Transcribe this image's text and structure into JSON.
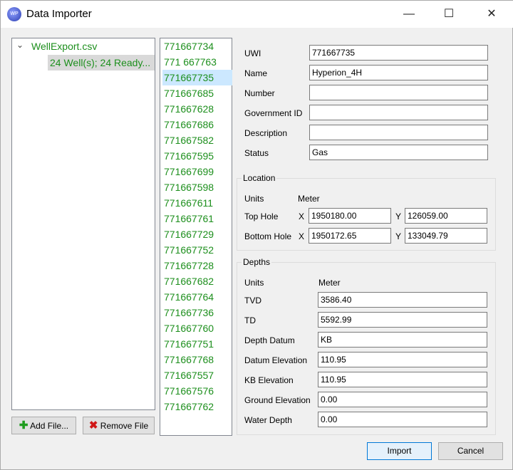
{
  "window": {
    "title": "Data Importer",
    "icon": "wp-logo-icon",
    "controls": [
      "minimize",
      "maximize",
      "close"
    ]
  },
  "tree": {
    "file": "WellExport.csv",
    "child": "24 Well(s); 24 Ready..."
  },
  "buttons": {
    "add_file": "Add File...",
    "remove_file": "Remove File",
    "import": "Import",
    "cancel": "Cancel"
  },
  "wells": [
    "771667734",
    "771 667763",
    "771667735",
    "771667685",
    "771667628",
    "771667686",
    "771667582",
    "771667595",
    "771667699",
    "771667598",
    "771667611",
    "771667761",
    "771667729",
    "771667752",
    "771667728",
    "771667682",
    "771667764",
    "771667736",
    "771667760",
    "771667751",
    "771667768",
    "771667557",
    "771667576",
    "771667762"
  ],
  "selected_well_index": 2,
  "fields": [
    {
      "label": "UWI",
      "value": "771667735"
    },
    {
      "label": "Name",
      "value": "Hyperion_4H"
    },
    {
      "label": "Number",
      "value": ""
    },
    {
      "label": "Government ID",
      "value": ""
    },
    {
      "label": "Description",
      "value": ""
    },
    {
      "label": "Status",
      "value": "Gas"
    }
  ],
  "location": {
    "title": "Location",
    "units_label": "Units",
    "units": "Meter",
    "x": "X",
    "y": "Y",
    "top": {
      "label": "Top Hole",
      "x": "1950180.00",
      "y": "126059.00"
    },
    "bottom": {
      "label": "Bottom Hole",
      "x": "1950172.65",
      "y": "133049.79"
    }
  },
  "depths": {
    "title": "Depths",
    "units_label": "Units",
    "units": "Meter",
    "fields": [
      {
        "label": "TVD",
        "value": "3586.40"
      },
      {
        "label": "TD",
        "value": "5592.99"
      },
      {
        "label": "Depth Datum",
        "value": "KB"
      },
      {
        "label": "Datum Elevation",
        "value": "110.95"
      },
      {
        "label": "KB Elevation",
        "value": "110.95"
      },
      {
        "label": "Ground Elevation",
        "value": "0.00"
      },
      {
        "label": "Water Depth",
        "value": "0.00"
      }
    ]
  },
  "colors": {
    "well_text": "#1d8f1d",
    "selection": "#cce8ff"
  }
}
